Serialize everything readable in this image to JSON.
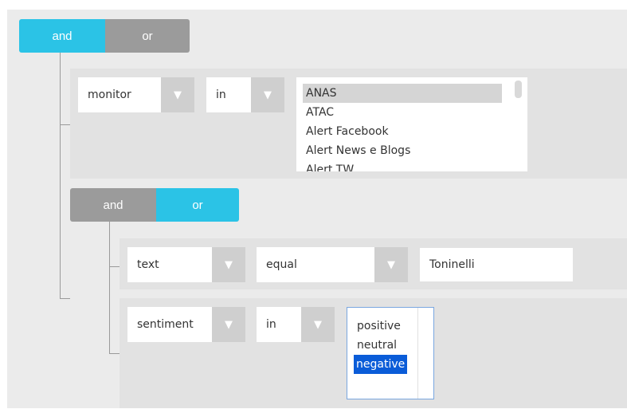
{
  "root_group": {
    "and_label": "and",
    "or_label": "or",
    "active": "and"
  },
  "rule_monitor": {
    "field": "monitor",
    "operator": "in",
    "options": [
      "ANAS",
      "ATAC",
      "Alert Facebook",
      "Alert News e Blogs",
      "Alert TW"
    ],
    "selected": "ANAS"
  },
  "nested_group": {
    "and_label": "and",
    "or_label": "or",
    "active": "or"
  },
  "rule_text": {
    "field": "text",
    "operator": "equal",
    "value": "Toninelli"
  },
  "rule_sentiment": {
    "field": "sentiment",
    "operator": "in",
    "options": [
      "positive",
      "neutral",
      "negative"
    ],
    "selected": "negative"
  },
  "icons": {
    "caret": "caret-down-icon"
  },
  "colors": {
    "active_toggle": "#2bc3e6",
    "inactive_toggle": "#9b9b9b",
    "selected_option_blue": "#0a5cd8"
  }
}
